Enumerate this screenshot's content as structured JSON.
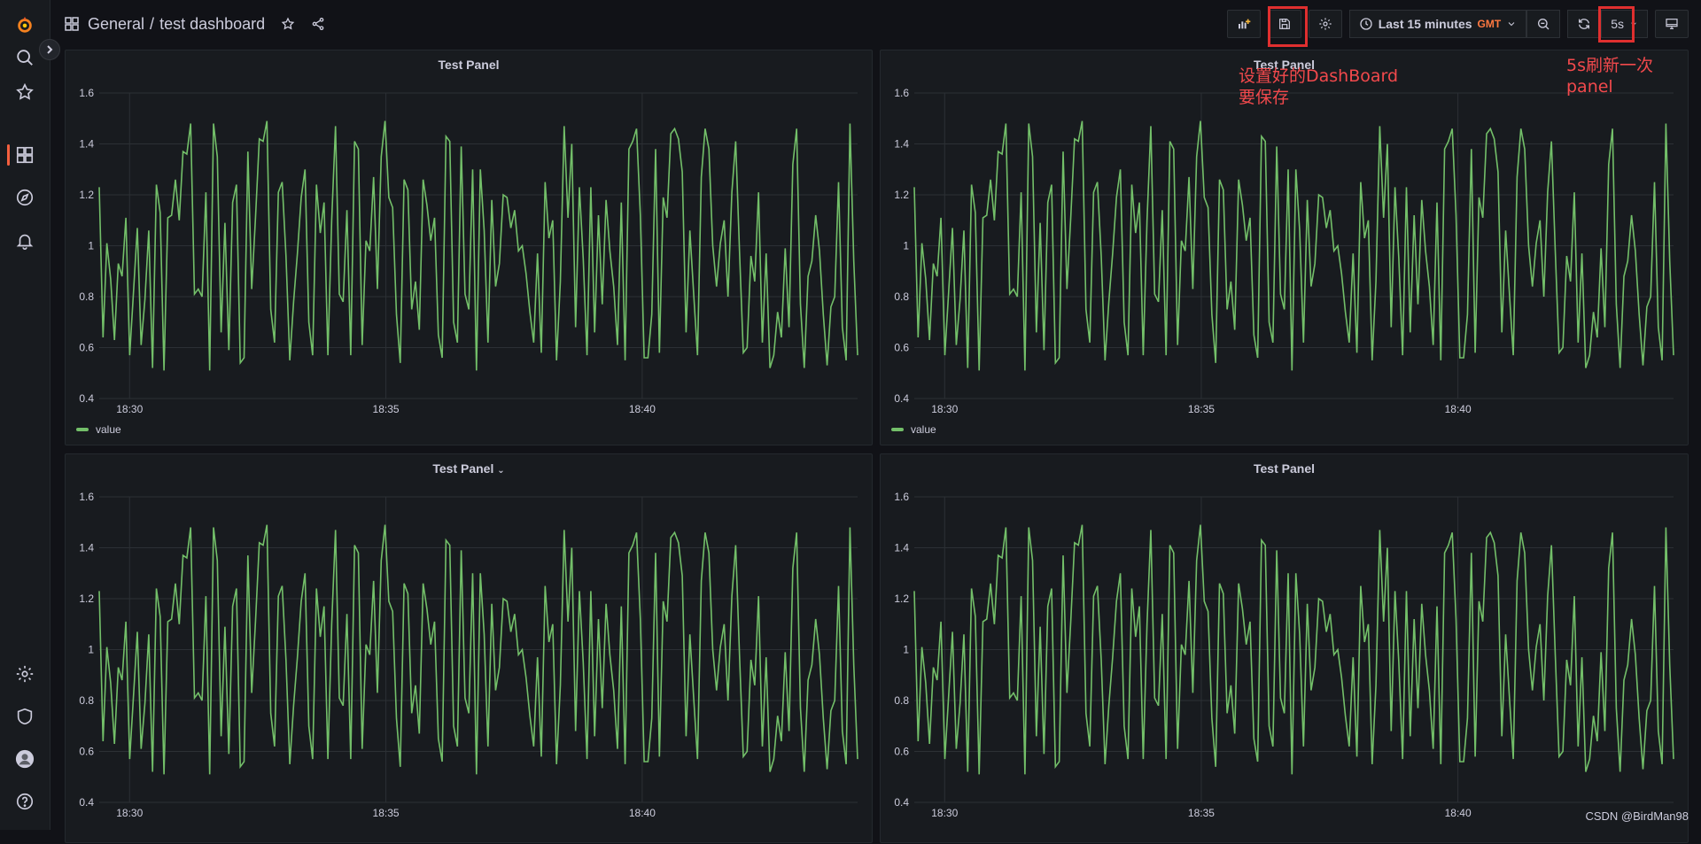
{
  "breadcrumb": {
    "folder": "General",
    "separator": "/",
    "dashboard": "test dashboard"
  },
  "toolbar": {
    "time_range": "Last 15 minutes",
    "timezone": "GMT",
    "refresh_interval": "5s"
  },
  "panels": [
    {
      "title": "Test Panel",
      "legend": "value"
    },
    {
      "title": "Test Panel",
      "legend": "value"
    },
    {
      "title": "Test Panel"
    },
    {
      "title": "Test Panel"
    }
  ],
  "chart_data": {
    "type": "line",
    "x_ticks": [
      "18:30",
      "18:35",
      "18:40"
    ],
    "y_ticks": [
      "1.6",
      "1.4",
      "1.2",
      "1",
      "0.8",
      "0.6",
      "0.4"
    ],
    "ylim": [
      0.4,
      1.6
    ],
    "series": [
      {
        "name": "value",
        "color": "#73bf69"
      }
    ],
    "values": [
      1.23,
      0.64,
      1.01,
      0.87,
      0.63,
      0.93,
      0.88,
      1.11,
      0.57,
      0.82,
      1.07,
      0.61,
      0.79,
      1.06,
      0.52,
      1.24,
      1.13,
      0.51,
      1.11,
      1.12,
      1.26,
      1.1,
      1.37,
      1.36,
      1.48,
      0.81,
      0.83,
      0.8,
      1.21,
      0.51,
      1.48,
      1.35,
      0.66,
      1.09,
      0.59,
      1.17,
      1.24,
      0.54,
      0.56,
      1.37,
      0.83,
      1.11,
      1.42,
      1.41,
      1.49,
      0.75,
      0.62,
      1.21,
      1.25,
      0.96,
      0.55,
      0.78,
      0.97,
      1.19,
      1.3,
      0.7,
      0.57,
      1.24,
      1.05,
      1.17,
      0.57,
      1.1,
      1.47,
      0.81,
      0.78,
      1.14,
      0.57,
      1.41,
      1.38,
      0.61,
      1.02,
      0.98,
      1.27,
      0.83,
      1.35,
      1.49,
      1.19,
      1.15,
      0.73,
      0.54,
      1.26,
      1.22,
      0.75,
      0.86,
      0.67,
      1.26,
      1.16,
      1.02,
      1.11,
      0.65,
      0.56,
      1.43,
      1.41,
      0.7,
      0.62,
      1.39,
      0.81,
      0.75,
      1.3,
      0.51,
      1.3,
      1.06,
      0.62,
      1.18,
      0.84,
      0.93,
      1.2,
      1.19,
      1.07,
      1.14,
      0.98,
      1.0,
      0.89,
      0.74,
      0.62,
      0.97,
      0.58,
      1.25,
      1.03,
      1.1,
      0.55,
      0.86,
      1.47,
      1.11,
      1.4,
      0.68,
      1.23,
      0.95,
      0.57,
      1.23,
      0.66,
      1.12,
      0.77,
      1.18,
      0.98,
      0.84,
      0.61,
      1.17,
      0.55,
      1.38,
      1.41,
      1.46,
      1.12,
      0.56,
      0.56,
      0.73,
      1.38,
      0.58,
      1.19,
      1.11,
      1.44,
      1.46,
      1.42,
      1.29,
      0.66,
      1.06,
      0.81,
      0.57,
      1.27,
      1.46,
      1.38,
      1.0,
      0.84,
      1.01,
      1.1,
      0.8,
      1.21,
      1.41,
      0.98,
      0.58,
      0.6,
      0.96,
      0.86,
      1.21,
      0.62,
      0.97,
      0.52,
      0.57,
      0.74,
      0.64,
      0.99,
      0.68,
      1.32,
      1.46,
      0.77,
      0.52,
      0.88,
      0.94,
      1.12,
      0.98,
      0.73,
      0.53,
      0.76,
      0.8,
      1.25,
      0.68,
      0.55,
      1.48,
      0.94,
      0.57
    ]
  },
  "annotations": {
    "save_note": "设置好的DashBoard\n要保存",
    "refresh_note": "5s刷新一次\npanel"
  },
  "watermark": "CSDN @BirdMan98"
}
